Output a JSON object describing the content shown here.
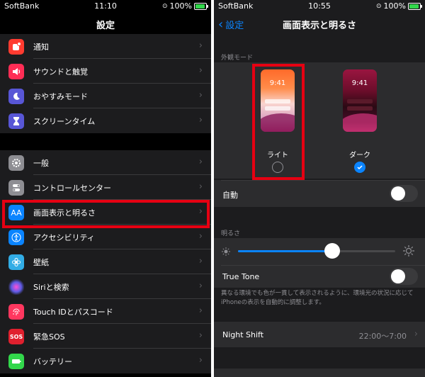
{
  "left": {
    "status": {
      "carrier": "SoftBank",
      "time": "11:10",
      "battery": "100%"
    },
    "title": "設定",
    "group1": [
      {
        "label": "通知",
        "icon": "bell-icon",
        "color": "#ff3b30"
      },
      {
        "label": "サウンドと触覚",
        "icon": "speaker-icon",
        "color": "#ff2d55"
      },
      {
        "label": "おやすみモード",
        "icon": "moon-icon",
        "color": "#5856d6"
      },
      {
        "label": "スクリーンタイム",
        "icon": "hourglass-icon",
        "color": "#5856d6"
      }
    ],
    "group2": [
      {
        "label": "一般",
        "icon": "gear-icon",
        "color": "#8e8e93"
      },
      {
        "label": "コントロールセンター",
        "icon": "toggles-icon",
        "color": "#8e8e93"
      },
      {
        "label": "画面表示と明るさ",
        "icon": "display-icon",
        "color": "#0a84ff",
        "glyph": "AA"
      },
      {
        "label": "アクセシビリティ",
        "icon": "accessibility-icon",
        "color": "#0a84ff"
      },
      {
        "label": "壁紙",
        "icon": "flower-icon",
        "color": "#32ade6"
      },
      {
        "label": "Siriと検索",
        "icon": "siri-icon",
        "color": "#1c1c1e"
      },
      {
        "label": "Touch IDとパスコード",
        "icon": "fingerprint-icon",
        "color": "#ff375f"
      },
      {
        "label": "緊急SOS",
        "icon": "sos-icon",
        "color": "#e0202e",
        "glyph": "SOS"
      },
      {
        "label": "バッテリー",
        "icon": "battery-icon",
        "color": "#32d74b"
      }
    ]
  },
  "right": {
    "status": {
      "carrier": "SoftBank",
      "time": "10:55",
      "battery": "100%"
    },
    "back_label": "設定",
    "title": "画面表示と明るさ",
    "appearance_header": "外観モード",
    "light_label": "ライト",
    "dark_label": "ダーク",
    "preview_time": "9:41",
    "auto_label": "自動",
    "brightness_header": "明るさ",
    "brightness_level": 0.6,
    "true_tone_label": "True Tone",
    "true_tone_note": "異なる環境でも色が一貫して表示されるように、環境光の状況に応じてiPhoneの表示を自動的に調整します。",
    "night_shift_label": "Night Shift",
    "night_shift_value": "22:00〜7:00",
    "accent": "#0a84ff",
    "highlight_color": "#e60012"
  }
}
